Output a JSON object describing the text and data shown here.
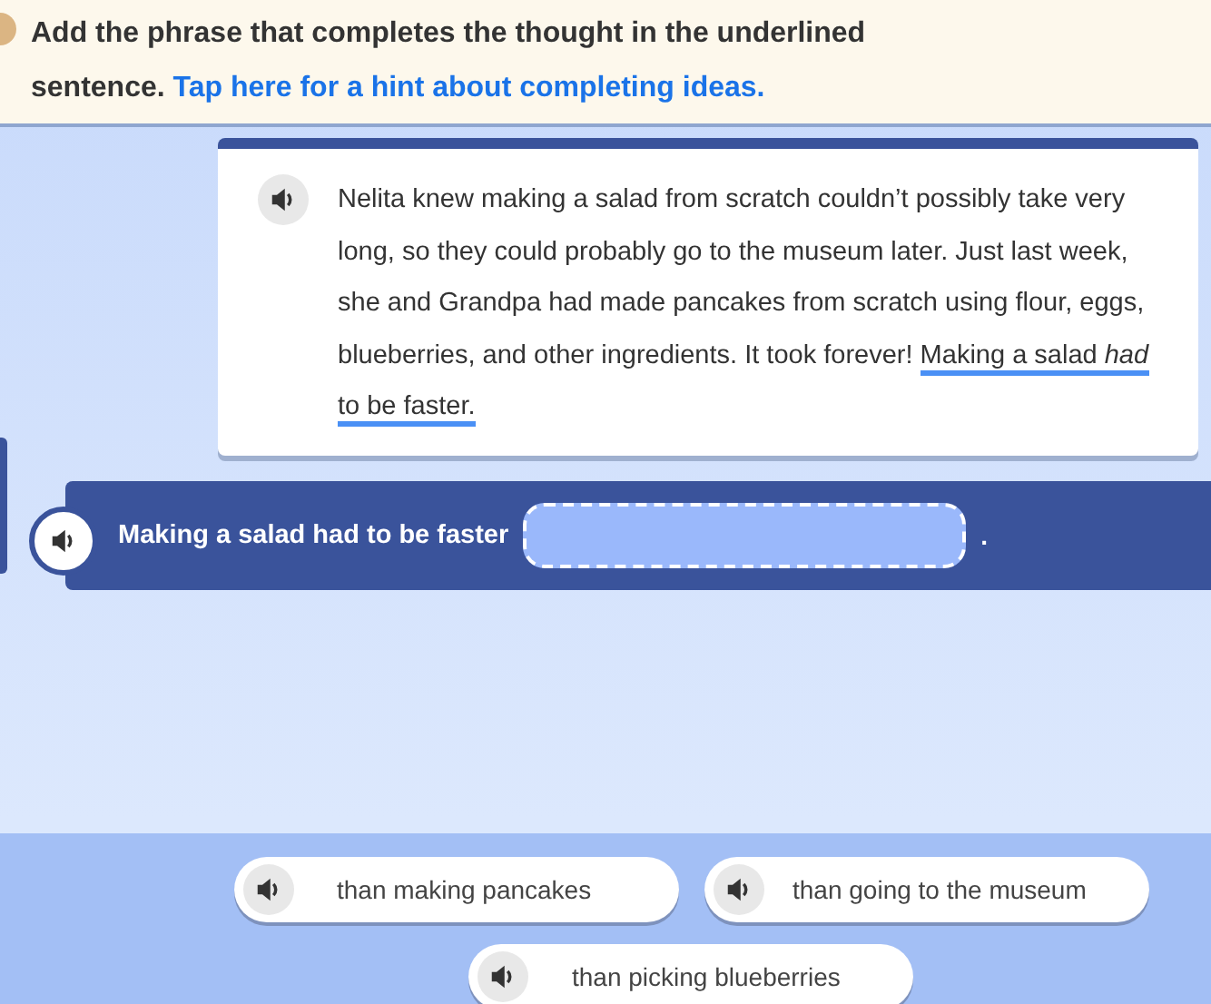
{
  "instruction": {
    "text": "Add the phrase that completes the thought in the underlined sentence.",
    "hint_link": "Tap here for a hint about completing ideas."
  },
  "passage": {
    "text": "Nelita knew making a salad from scratch couldn’t possibly take very long, so they could probably go to the museum later. Just last week, she and Grandpa had made pancakes from scratch using flour, eggs, blueberries, and other ingredients. It took forever!",
    "underlined": "Making a salad *had* to be faster."
  },
  "sentence": {
    "text": "Making a salad had to be faster",
    "end": "."
  },
  "choices": [
    {
      "label": "than making pancakes"
    },
    {
      "label": "than going to the museum"
    },
    {
      "label": "than picking blueberries"
    }
  ]
}
